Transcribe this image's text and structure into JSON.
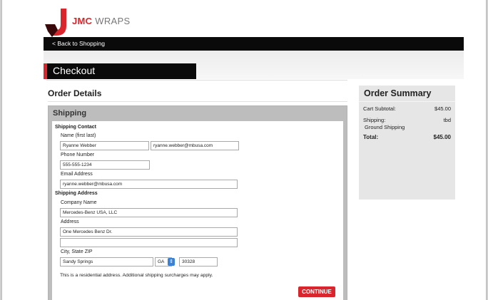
{
  "brand": {
    "name_bold": "JMC",
    "name_rest": " WRAPS"
  },
  "nav": {
    "back_label": "< Back to Shopping"
  },
  "page_title": "Checkout",
  "order_details": {
    "title": "Order Details",
    "shipping_header": "Shipping",
    "contact_section": "Shipping Contact",
    "name_label": "Name (first last)",
    "name_value": "Ryanne Webber",
    "name_second_value": "ryanne.webber@mbusa.com",
    "phone_label": "Phone Number",
    "phone_value": "555-555-1234",
    "email_label": "Email Address",
    "email_value": "ryanne.webber@mbusa.com",
    "address_section": "Shipping Address",
    "company_label": "Company Name",
    "company_value": "Mercedes-Benz USA, LLC",
    "address_label": "Address",
    "address_line1": "One Mercedes Benz Dr.",
    "address_line2": "",
    "city_label": "City, State ZIP",
    "city_value": "Sandy Springs",
    "state_value": "GA",
    "zip_value": "30328",
    "residential_note": "This is a residential address. Additional shipping surcharges may apply.",
    "continue_label": "CONTINUE"
  },
  "summary": {
    "title": "Order Summary",
    "subtotal_label": "Cart Subtotal:",
    "subtotal_value": "$45.00",
    "shipping_label": "Shipping:",
    "shipping_value": "tbd",
    "shipping_method": "Ground Shipping",
    "total_label": "Total:",
    "total_value": "$45.00"
  },
  "colors": {
    "accent": "#d8262c",
    "navbar": "#0a0a0a",
    "select_button": "#3b82d6"
  },
  "icons": {
    "logo": "jmc-logo-icon",
    "select_arrow": "select-arrows-icon"
  }
}
